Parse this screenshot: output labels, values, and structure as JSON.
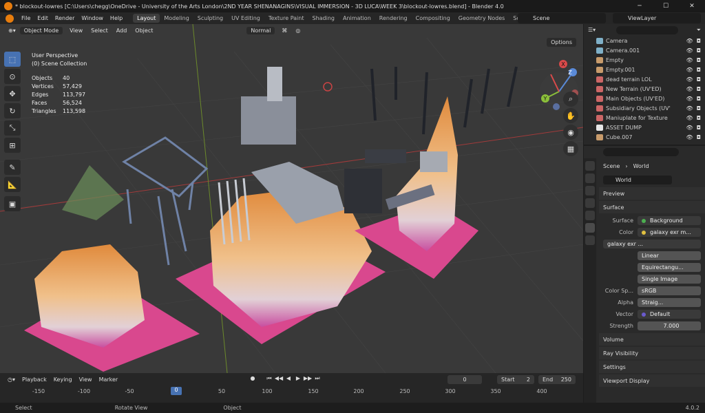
{
  "titlebar": {
    "title": "* blockout-lowres [C:\\Users\\chegg\\OneDrive - University of the Arts London\\2ND YEAR SHENANAGINS\\VISUAL IMMERSION - 3D LUCA\\WEEK 3\\blockout-lowres.blend] - Blender 4.0",
    "minimize": "─",
    "maximize": "☐",
    "close": "✕"
  },
  "menubar": {
    "items": [
      "File",
      "Edit",
      "Render",
      "Window",
      "Help"
    ],
    "workspaces": [
      "Layout",
      "Modeling",
      "Sculpting",
      "UV Editing",
      "Texture Paint",
      "Shading",
      "Animation",
      "Rendering",
      "Compositing",
      "Geometry Nodes",
      "Scriptin"
    ],
    "active_workspace": "Layout",
    "scene": "Scene",
    "view_layer": "ViewLayer"
  },
  "viewport": {
    "mode": "Object Mode",
    "menus": [
      "View",
      "Select",
      "Add",
      "Object"
    ],
    "orientation": "Normal",
    "options": "Options",
    "perspective": "User Perspective",
    "collection": "(0) Scene Collection",
    "stats": [
      {
        "label": "Objects",
        "value": "40"
      },
      {
        "label": "Vertices",
        "value": "57,429"
      },
      {
        "label": "Edges",
        "value": "113,797"
      },
      {
        "label": "Faces",
        "value": "56,524"
      },
      {
        "label": "Triangles",
        "value": "113,598"
      }
    ],
    "gizmo": {
      "x": "X",
      "y": "Y",
      "z": "Z"
    }
  },
  "timeline": {
    "menus": [
      "Playback",
      "Keying",
      "View",
      "Marker"
    ],
    "current_frame": "0",
    "start_label": "Start",
    "start": "2",
    "end_label": "End",
    "end": "250",
    "ruler": [
      "-150",
      "-100",
      "-50",
      "0",
      "50",
      "100",
      "150",
      "200",
      "250",
      "300",
      "350",
      "400"
    ]
  },
  "statusbar": {
    "items": [
      "Select",
      "Rotate View",
      "Object"
    ],
    "version": "4.0.2"
  },
  "outliner": {
    "items": [
      {
        "name": "Camera",
        "color": "#7fb0c8"
      },
      {
        "name": "Camera.001",
        "color": "#7fb0c8"
      },
      {
        "name": "Empty",
        "color": "#c89b6b"
      },
      {
        "name": "Empty.001",
        "color": "#c89b6b"
      },
      {
        "name": "dead terrain LOL",
        "color": "#c66"
      },
      {
        "name": "New Terrain (UV'ED)",
        "color": "#c66"
      },
      {
        "name": "Main Objects (UV'ED)",
        "color": "#c66"
      },
      {
        "name": "Subsidiary Objects (UV'",
        "color": "#c66"
      },
      {
        "name": "Maniuplate for Texture",
        "color": "#c66"
      },
      {
        "name": "ASSET DUMP",
        "color": "#e6e6e6"
      },
      {
        "name": "Cube.007",
        "color": "#c89b6b"
      }
    ]
  },
  "properties": {
    "breadcrumb": [
      "Scene",
      "World"
    ],
    "world": "World",
    "panels": {
      "preview": "Preview",
      "surface": "Surface",
      "volume": "Volume",
      "ray_visibility": "Ray Visibility",
      "settings": "Settings",
      "viewport_display": "Viewport Display"
    },
    "surface": {
      "label": "Surface",
      "value": "Background"
    },
    "color": {
      "label": "Color",
      "value": "galaxy exr m..."
    },
    "image": "galaxy exr ...",
    "interpolation": "Linear",
    "projection": "Equirectangu...",
    "source": "Single Image",
    "color_space": {
      "label": "Color Sp...",
      "value": "sRGB"
    },
    "alpha": {
      "label": "Alpha",
      "value": "Straig..."
    },
    "vector": {
      "label": "Vector",
      "value": "Default"
    },
    "strength": {
      "label": "Strength",
      "value": "7.000"
    }
  }
}
